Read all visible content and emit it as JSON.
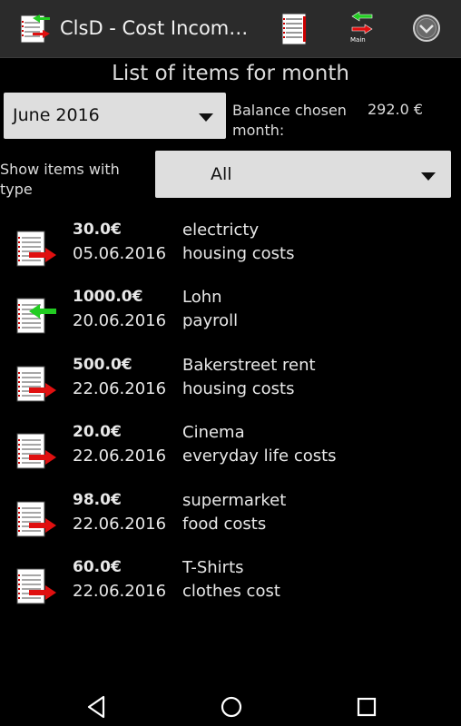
{
  "app": {
    "title": "ClsD - Cost Incom…",
    "main_label": "Main"
  },
  "page_title": "List of items for month",
  "month_spinner": {
    "value": "June 2016"
  },
  "balance": {
    "label": "Balance chosen month:",
    "value": "292.0 €"
  },
  "type_filter": {
    "label": "Show items with type",
    "value": "All"
  },
  "items": [
    {
      "amount": "30.0€",
      "date": "05.06.2016",
      "name": "electricty",
      "category": "housing costs",
      "direction": "expense"
    },
    {
      "amount": "1000.0€",
      "date": "20.06.2016",
      "name": "Lohn",
      "category": "payroll",
      "direction": "income"
    },
    {
      "amount": "500.0€",
      "date": "22.06.2016",
      "name": "Bakerstreet rent",
      "category": "housing costs",
      "direction": "expense"
    },
    {
      "amount": "20.0€",
      "date": "22.06.2016",
      "name": "Cinema",
      "category": "everyday life costs",
      "direction": "expense"
    },
    {
      "amount": "98.0€",
      "date": "22.06.2016",
      "name": "supermarket",
      "category": "food costs",
      "direction": "expense"
    },
    {
      "amount": "60.0€",
      "date": "22.06.2016",
      "name": "T-Shirts",
      "category": "clothes cost",
      "direction": "expense"
    }
  ],
  "colors": {
    "expense_arrow": "#e01010",
    "income_arrow": "#22cc22",
    "actionbar": "#2b2b2b"
  }
}
